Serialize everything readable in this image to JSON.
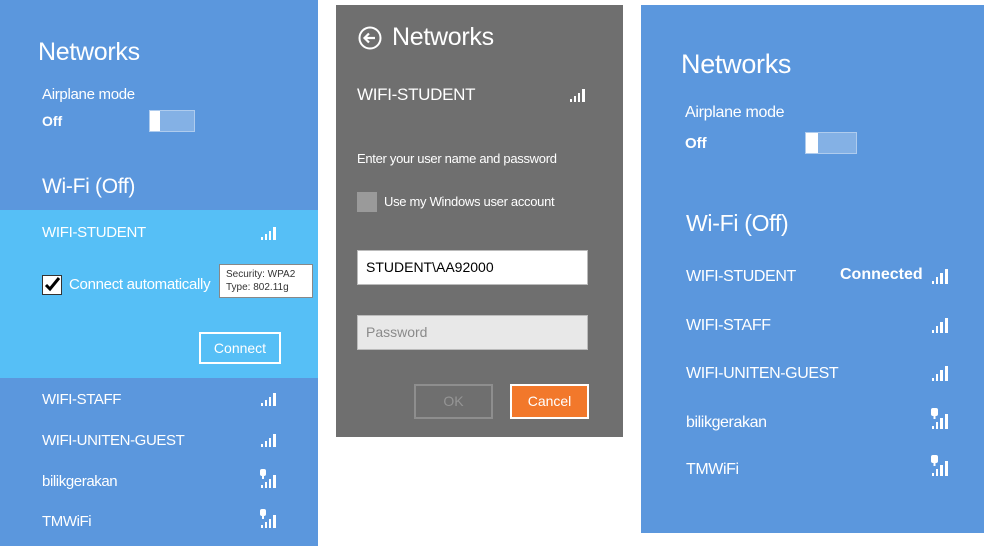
{
  "left_panel": {
    "title": "Networks",
    "airplane_label": "Airplane mode",
    "airplane_value": "Off",
    "wifi_section": "Wi-Fi (Off)",
    "selected_network": "WIFI-STUDENT",
    "connect_auto_label": "Connect automatically",
    "tooltip_security": "Security: WPA2",
    "tooltip_type": "Type: 802.11g",
    "connect_button": "Connect",
    "networks": [
      "WIFI-STAFF",
      "WIFI-UNITEN-GUEST",
      "bilikgerakan",
      "TMWiFi"
    ]
  },
  "middle_panel": {
    "title": "Networks",
    "network_name": "WIFI-STUDENT",
    "prompt": "Enter your user name and password",
    "use_windows_account": "Use my Windows user account",
    "username_value": "STUDENT\\AA92000",
    "password_placeholder": "Password",
    "ok_button": "OK",
    "cancel_button": "Cancel"
  },
  "right_panel": {
    "title": "Networks",
    "airplane_label": "Airplane mode",
    "airplane_value": "Off",
    "wifi_section": "Wi-Fi (Off)",
    "networks": [
      {
        "name": "WIFI-STUDENT",
        "status": "Connected"
      },
      {
        "name": "WIFI-STAFF",
        "status": ""
      },
      {
        "name": "WIFI-UNITEN-GUEST",
        "status": ""
      },
      {
        "name": "bilikgerakan",
        "status": ""
      },
      {
        "name": "TMWiFi",
        "status": ""
      }
    ]
  },
  "colors": {
    "panel_blue": "#5b97dd",
    "selected_blue": "#56bff6",
    "dialog_gray": "#6f6f6f",
    "cancel_orange": "#f2782b"
  },
  "icons": {
    "signal": "wifi-signal-icon",
    "secured_signal": "secured-signal-icon",
    "back": "back-arrow-icon",
    "check": "checkmark-icon"
  }
}
